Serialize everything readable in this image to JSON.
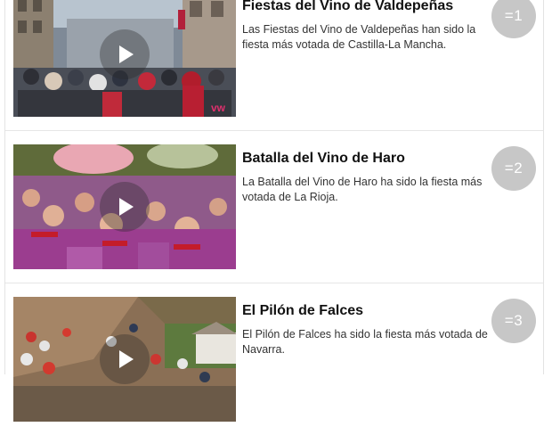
{
  "items": [
    {
      "title": "Fiestas del Vino de Valdepeñas",
      "description": "Las Fiestas del Vino de Valdepeñas han sido la fiesta más votada de Castilla-La Mancha.",
      "rank": "=1",
      "thumbnail_logo": "vw",
      "thumbnail_scene": "street-crowd"
    },
    {
      "title": "Batalla del Vino de Haro",
      "description": "La Batalla del Vino de Haro ha sido la fiesta más votada de La Rioja.",
      "rank": "=2",
      "thumbnail_scene": "wine-battle-crowd"
    },
    {
      "title": "El Pilón de Falces",
      "description": "El Pilón de Falces ha sido la fiesta más votada de Navarra.",
      "rank": "=3",
      "thumbnail_scene": "hillside-crowd"
    }
  ],
  "colors": {
    "badge_bg": "#c7c7c7",
    "title": "#111111",
    "text": "#333333"
  },
  "icons": {
    "play": "play-icon"
  }
}
